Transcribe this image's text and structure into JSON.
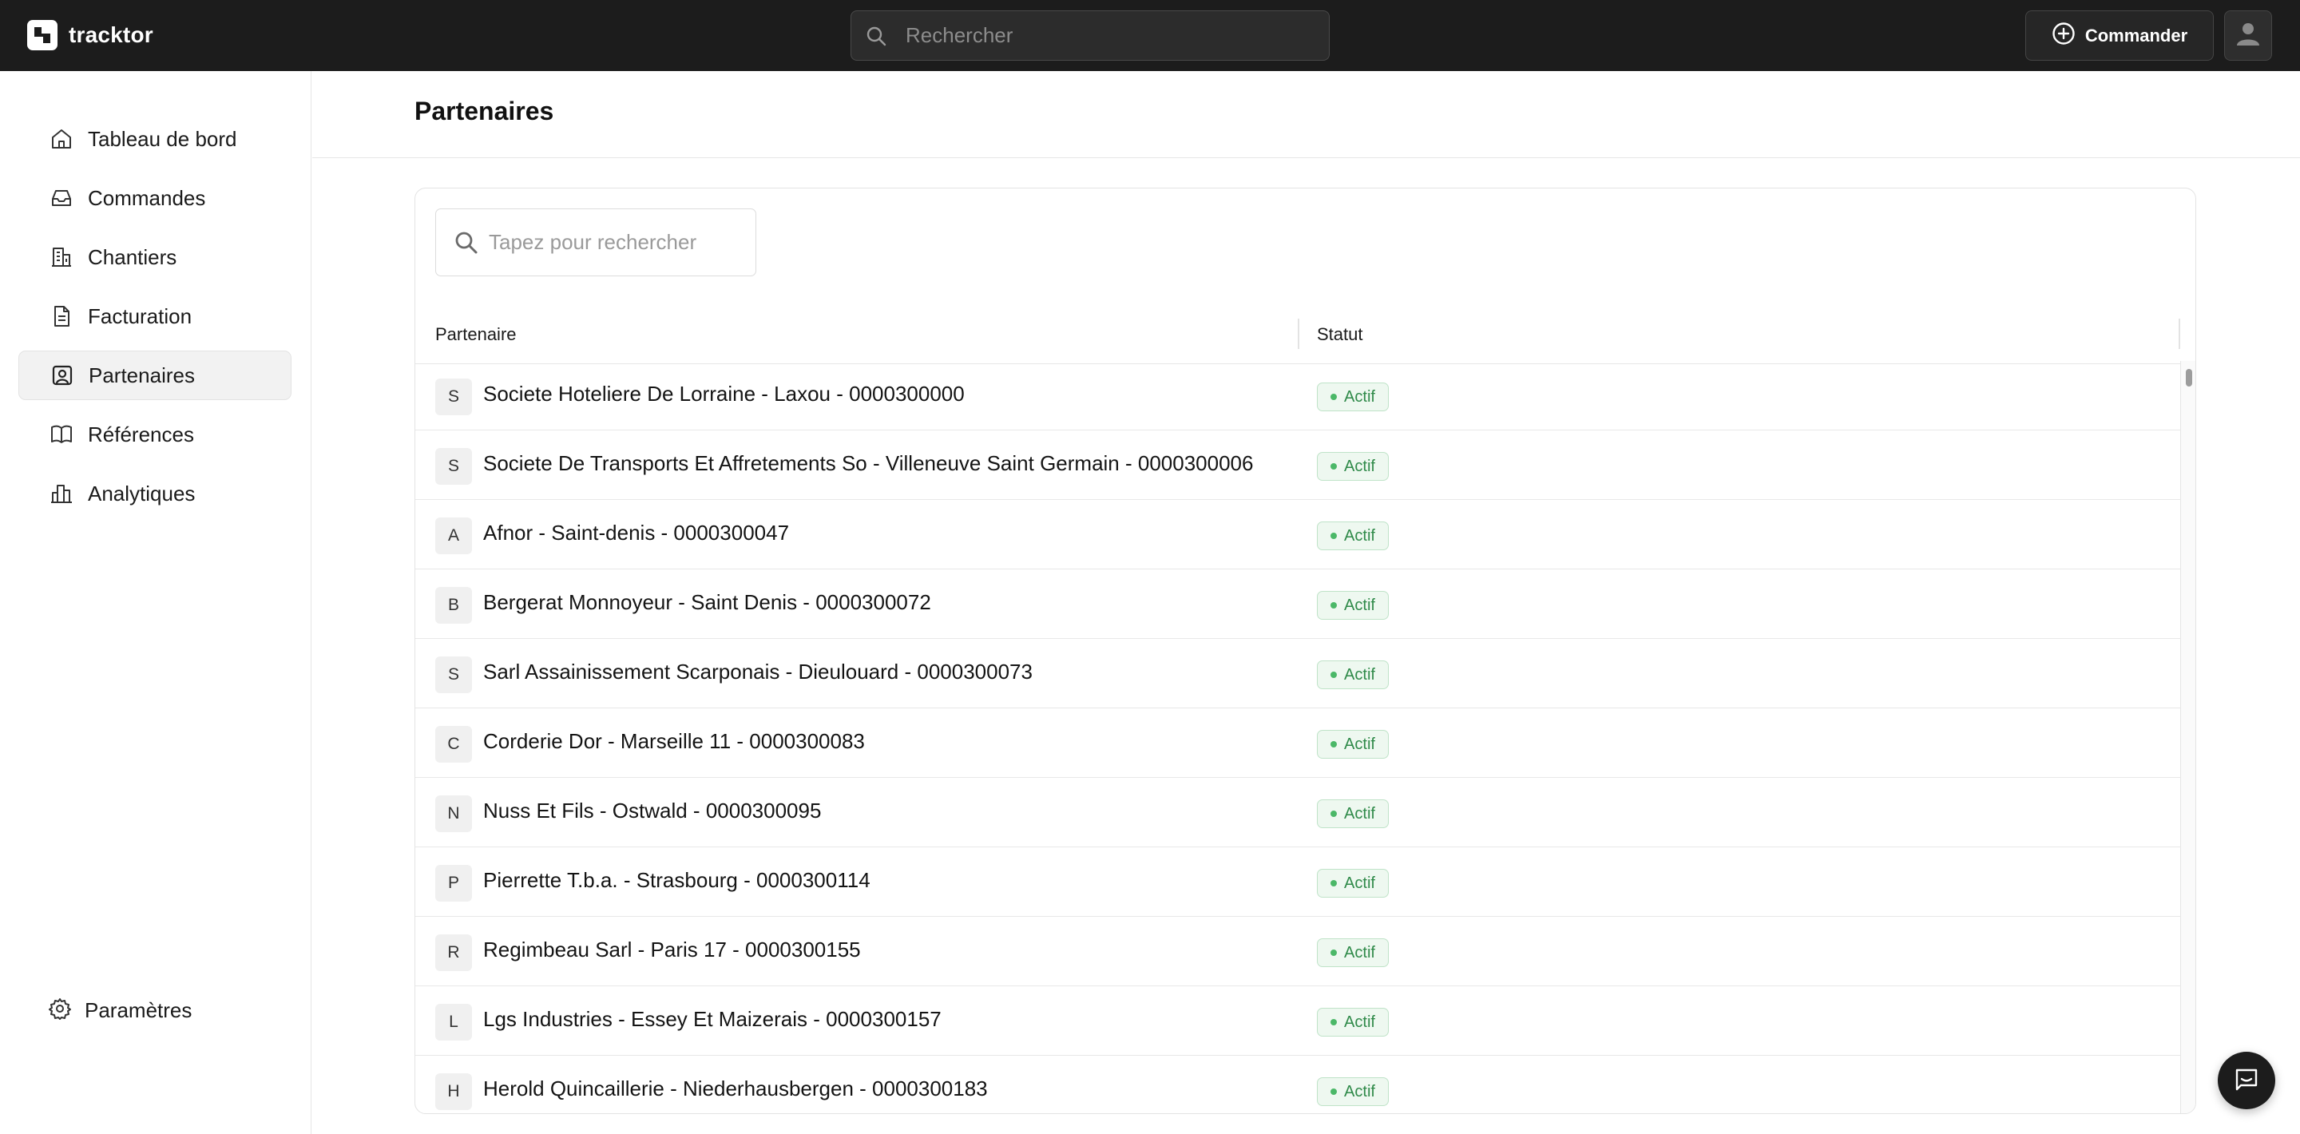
{
  "app": {
    "name": "tracktor"
  },
  "topbar": {
    "search_placeholder": "Rechercher",
    "order_button_label": "Commander"
  },
  "sidebar": {
    "items": [
      {
        "label": "Tableau de bord",
        "icon": "home-icon",
        "active": false
      },
      {
        "label": "Commandes",
        "icon": "inbox-icon",
        "active": false
      },
      {
        "label": "Chantiers",
        "icon": "building-icon",
        "active": false
      },
      {
        "label": "Facturation",
        "icon": "document-icon",
        "active": false
      },
      {
        "label": "Partenaires",
        "icon": "contact-icon",
        "active": true
      },
      {
        "label": "Références",
        "icon": "book-icon",
        "active": false
      },
      {
        "label": "Analytiques",
        "icon": "bar-chart-icon",
        "active": false
      }
    ],
    "settings_label": "Paramètres"
  },
  "page": {
    "title": "Partenaires"
  },
  "table": {
    "search_placeholder": "Tapez pour rechercher",
    "columns": [
      "Partenaire",
      "Statut"
    ],
    "rows": [
      {
        "initial": "S",
        "name": "Societe Hoteliere De Lorraine - Laxou - 0000300000",
        "status": "Actif"
      },
      {
        "initial": "S",
        "name": "Societe De Transports Et Affretements So - Villeneuve Saint Germain - 0000300006",
        "status": "Actif"
      },
      {
        "initial": "A",
        "name": "Afnor - Saint-denis - 0000300047",
        "status": "Actif"
      },
      {
        "initial": "B",
        "name": "Bergerat Monnoyeur - Saint Denis - 0000300072",
        "status": "Actif"
      },
      {
        "initial": "S",
        "name": "Sarl Assainissement Scarponais - Dieulouard - 0000300073",
        "status": "Actif"
      },
      {
        "initial": "C",
        "name": "Corderie Dor - Marseille 11 - 0000300083",
        "status": "Actif"
      },
      {
        "initial": "N",
        "name": "Nuss Et Fils - Ostwald - 0000300095",
        "status": "Actif"
      },
      {
        "initial": "P",
        "name": "Pierrette T.b.a. - Strasbourg - 0000300114",
        "status": "Actif"
      },
      {
        "initial": "R",
        "name": "Regimbeau Sarl - Paris 17 - 0000300155",
        "status": "Actif"
      },
      {
        "initial": "L",
        "name": "Lgs Industries - Essey Et Maizerais - 0000300157",
        "status": "Actif"
      },
      {
        "initial": "H",
        "name": "Herold Quincaillerie - Niederhausbergen - 0000300183",
        "status": "Actif"
      }
    ]
  },
  "colors": {
    "topbar_bg": "#1c1c1c",
    "status_green": "#2f8a49",
    "status_bg": "#eef8f0"
  }
}
